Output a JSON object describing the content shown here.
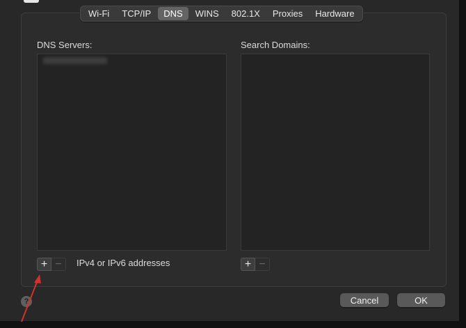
{
  "tabs": [
    {
      "label": "Wi-Fi",
      "active": false
    },
    {
      "label": "TCP/IP",
      "active": false
    },
    {
      "label": "DNS",
      "active": true
    },
    {
      "label": "WINS",
      "active": false
    },
    {
      "label": "802.1X",
      "active": false
    },
    {
      "label": "Proxies",
      "active": false
    },
    {
      "label": "Hardware",
      "active": false
    }
  ],
  "dns_servers": {
    "label": "DNS Servers:",
    "add_symbol": "+",
    "remove_symbol": "−",
    "hint": "IPv4 or IPv6 addresses"
  },
  "search_domains": {
    "label": "Search Domains:",
    "add_symbol": "+",
    "remove_symbol": "−"
  },
  "footer": {
    "help_symbol": "?",
    "cancel_label": "Cancel",
    "ok_label": "OK"
  },
  "annotation": {
    "arrow_color": "#d0322c"
  }
}
